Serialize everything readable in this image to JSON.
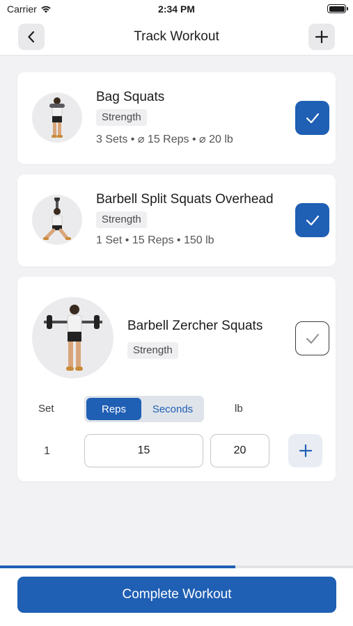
{
  "status_bar": {
    "carrier": "Carrier",
    "time": "2:34 PM"
  },
  "nav": {
    "title": "Track Workout",
    "back_icon": "chevron-left-icon",
    "add_icon": "plus-icon"
  },
  "exercises": [
    {
      "name": "Bag Squats",
      "tag": "Strength",
      "summary": "3 Sets • ⌀ 15 Reps • ⌀ 20 lb",
      "completed": true
    },
    {
      "name": "Barbell Split Squats Overhead",
      "tag": "Strength",
      "summary": "1 Set • 15 Reps • 150 lb",
      "completed": true
    },
    {
      "name": "Barbell Zercher Squats",
      "tag": "Strength",
      "completed": false,
      "editor": {
        "set_header": "Set",
        "mode_options": [
          "Reps",
          "Seconds"
        ],
        "selected_mode": "Reps",
        "unit_header": "lb",
        "rows": [
          {
            "set": "1",
            "reps": "15",
            "weight": "20"
          }
        ]
      }
    }
  ],
  "progress": 0.667,
  "complete_button": "Complete Workout",
  "colors": {
    "accent": "#1f5fb4",
    "background": "#f2f2f4"
  }
}
